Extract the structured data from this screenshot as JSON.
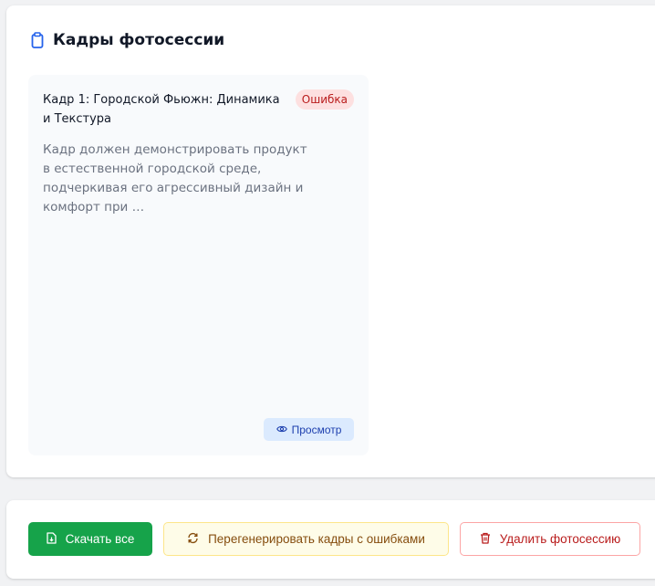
{
  "panel": {
    "title": "Кадры фотосессии",
    "icon": "clipboard-icon"
  },
  "cards": [
    {
      "title": "Кадр 1: Городской Фьюжн: Динамика и Текстура",
      "status": "Ошибка",
      "description": "Кадр должен демонстрировать продукт в естественной городской среде, подчеркивая его агрессивный дизайн и комфорт при …",
      "view_label": "Просмотр",
      "view_icon": "eye-icon"
    }
  ],
  "actions": {
    "download_label": "Скачать все",
    "regenerate_label": "Перегенерировать кадры с ошибками",
    "delete_label": "Удалить фотосессию"
  },
  "colors": {
    "download": "#16a34a",
    "regenerate_bg": "#fefce8",
    "delete_border": "#fca5a5",
    "error_badge_bg": "#fde0e0",
    "view_bg": "#dbeafe"
  }
}
